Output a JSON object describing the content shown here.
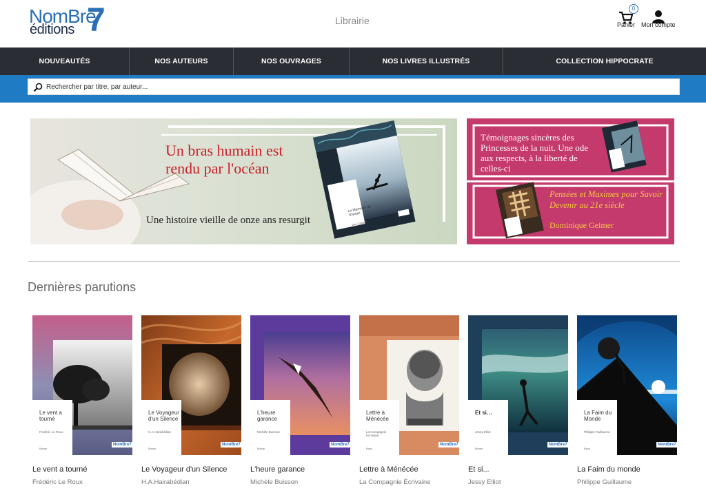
{
  "header": {
    "logo_nombre": "NomBre",
    "logo_seven": "7",
    "logo_editions": "éditions",
    "section": "Librairie",
    "cart_count": "0",
    "cart_label": "Panier",
    "account_label": "Mon compte"
  },
  "nav": {
    "items": [
      "NOUVEAUTÉS",
      "NOS AUTEURS",
      "NOS OUVRAGES",
      "NOS LIVRES ILLUSTRÉS",
      "COLLECTION HIPPOCRATE"
    ]
  },
  "search": {
    "placeholder": "Rechercher par titre, par auteur..."
  },
  "banner_left": {
    "headline": "Un bras humain est rendu par l'océan",
    "tagline": "Une histoire vieille de onze ans resurgit",
    "book_title": "Le Murmure de l'Océan",
    "book_author": "Dan Cregan"
  },
  "banner_right": {
    "top_text": "Témoignages sincères des Princesses de la nuit. Une ode aux respects, à la liberté de celles-ci",
    "bottom_title": "Pensées et Maximes pour Savoir Devenir au 21e siècle",
    "bottom_author": "Dominique Geimer"
  },
  "section_title": "Dernières parutions",
  "books": [
    {
      "title": "Le vent a tourné",
      "author": "Frédéric Le Roux",
      "cover_title": "Le vent a tourné",
      "cover_author": "Frédéric Le Roux",
      "cover_genre": "Roman"
    },
    {
      "title": "Le Voyageur d'un Silence",
      "author": "H.A.Hairabédian",
      "cover_title": "Le Voyageur d'un Silence",
      "cover_author": "H.A.Hairabédian",
      "cover_genre": "Roman"
    },
    {
      "title": "L'heure garance",
      "author": "Michèle Buisson",
      "cover_title": "L'heure garance",
      "cover_author": "Michèle Buisson",
      "cover_genre": "Roman"
    },
    {
      "title": "Lettre à Ménécée",
      "author": "La Compagnie Écrivaine",
      "cover_title": "Lettre à Ménécée",
      "cover_author": "La Compagnie Écrivaine",
      "cover_genre": "Essai"
    },
    {
      "title": "Et si...",
      "author": "Jessy Elliot",
      "cover_title": "Et si…",
      "cover_author": "Jessy Elliot",
      "cover_genre": "Roman"
    },
    {
      "title": "La Faim du monde",
      "author": "Philippe Guillaume",
      "cover_title": "La Faim du Monde",
      "cover_author": "Philippe Guillaume",
      "cover_genre": "Essai"
    }
  ],
  "mini_logo": "NomBre7",
  "colors": {
    "brand_blue": "#2b6fb5",
    "nav_bg": "#2a2d33",
    "search_bg": "#1f7bc3",
    "banner_pink": "#c43a6c",
    "banner_green": "#cfdbc6"
  }
}
